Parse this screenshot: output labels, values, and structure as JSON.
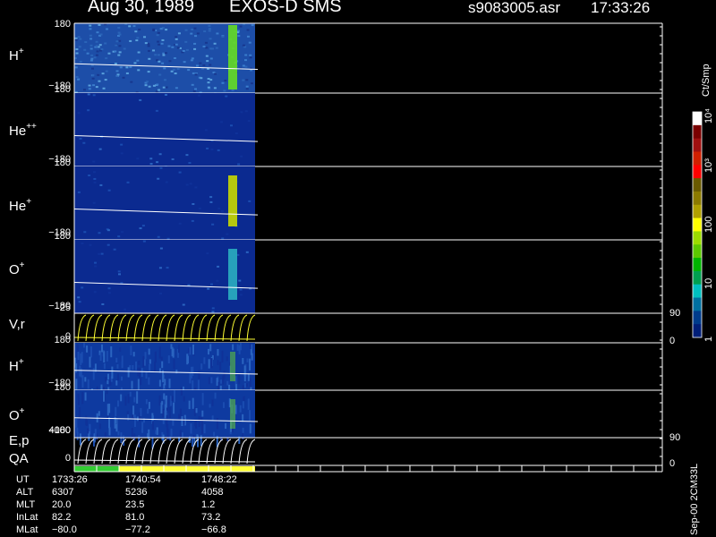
{
  "header": {
    "date": "Aug 30, 1989",
    "instrument": "EXOS-D SMS",
    "file": "s9083005.asr",
    "time": "17:33:26"
  },
  "colorbar": {
    "unit": "Ct/Smp",
    "ticks": [
      "10⁴",
      "10³",
      "100",
      "10",
      "1"
    ],
    "colors": [
      "#ffffff",
      "#7a0000",
      "#a01010",
      "#d02000",
      "#ff0000",
      "#6a5a00",
      "#8c7a00",
      "#b0a000",
      "#ffff00",
      "#9cdc00",
      "#5cc800",
      "#00b400",
      "#00a050",
      "#00c0c0",
      "#0070a0",
      "#003c8c",
      "#001e78"
    ]
  },
  "panels": [
    {
      "id": "hplus-pitch",
      "label": "H",
      "sup": "+",
      "ymax": "180",
      "ymin": "−180"
    },
    {
      "id": "heplusplus-pitch",
      "label": "He",
      "sup": "++",
      "ymax": "180",
      "ymin": "−180"
    },
    {
      "id": "heplus-pitch",
      "label": "He",
      "sup": "+",
      "ymax": "180",
      "ymin": "−180"
    },
    {
      "id": "oplus-pitch",
      "label": "O",
      "sup": "+",
      "ymax": "180",
      "ymin": "−180"
    },
    {
      "id": "vr",
      "label": "V,r",
      "sup": "",
      "ymax": "25",
      "ymin": "0",
      "rmax": "90",
      "rmin": "0"
    },
    {
      "id": "hplus-2",
      "label": "H",
      "sup": "+",
      "ymax": "180",
      "ymin": "−180"
    },
    {
      "id": "oplus-2",
      "label": "O",
      "sup": "+",
      "ymax": "180",
      "ymin": "−180"
    },
    {
      "id": "ep",
      "label": "E,p",
      "sup": "",
      "ymax": "4000",
      "ymin": "0",
      "rmax": "90",
      "rmin": "0"
    },
    {
      "id": "qa",
      "label": "QA",
      "sup": "",
      "ymax": "",
      "ymin": ""
    }
  ],
  "footer": {
    "rows": [
      {
        "name": "UT",
        "values": [
          "1733:26",
          "1740:54",
          "1748:22"
        ]
      },
      {
        "name": "ALT",
        "values": [
          "6307",
          "5236",
          "4058"
        ]
      },
      {
        "name": "MLT",
        "values": [
          "20.0",
          "23.5",
          "1.2"
        ]
      },
      {
        "name": "InLat",
        "values": [
          "82.2",
          "81.0",
          "73.2"
        ]
      },
      {
        "name": "MLat",
        "values": [
          "−80.0",
          "−77.2",
          "−66.8"
        ]
      }
    ],
    "version": "Sep-00 2CM33L"
  },
  "chart_data": {
    "type": "heatmap",
    "x_ut_ticks": [
      "1733:26",
      "1740:54",
      "1748:22"
    ],
    "qa_segments": [
      {
        "fraction": 0.25,
        "color": "#33cc33"
      },
      {
        "fraction": 0.75,
        "color": "#ffff33"
      }
    ],
    "panels": [
      {
        "label": "H+",
        "y_range": [
          -180,
          180
        ],
        "background": "#1d4ea8",
        "hot_band_color": "#66dd22"
      },
      {
        "label": "He++",
        "y_range": [
          -180,
          180
        ],
        "background": "#0b2a90"
      },
      {
        "label": "He+",
        "y_range": [
          -180,
          180
        ],
        "background": "#0b2a90",
        "hot_band_color": "#c8d800"
      },
      {
        "label": "O+",
        "y_range": [
          -180,
          180
        ],
        "background": "#0b2a90",
        "hot_band_color": "#2aaec0"
      },
      {
        "label": "V,r",
        "y_range": [
          0,
          25
        ],
        "right_range": [
          0,
          90
        ]
      },
      {
        "label": "H+",
        "y_range": [
          -180,
          180
        ],
        "background": "#0e3aa0"
      },
      {
        "label": "O+",
        "y_range": [
          -180,
          180
        ],
        "background": "#0e3aa0"
      },
      {
        "label": "E,p",
        "y_range": [
          0,
          4000
        ],
        "right_range": [
          0,
          90
        ]
      },
      {
        "label": "QA"
      }
    ]
  }
}
